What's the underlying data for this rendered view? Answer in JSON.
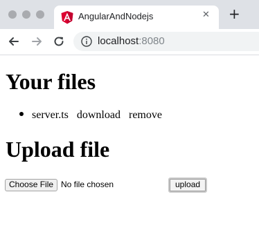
{
  "browser": {
    "tab_title": "AngularAndNodejs",
    "tab_close_glyph": "✕",
    "new_tab_glyph": "+",
    "url_host": "localhost",
    "url_port": ":8080",
    "favicon": "angular-logo",
    "colors": {
      "tabstrip": "#dee1e6",
      "favicon": "#dd0031",
      "traffic_light": "#a9abaf"
    }
  },
  "page": {
    "files_heading": "Your files",
    "files": [
      {
        "name": "server.ts",
        "download_label": "download",
        "remove_label": "remove"
      }
    ],
    "upload_heading": "Upload file",
    "choose_file_label": "Choose File",
    "no_file_text": "No file chosen",
    "upload_label": "upload"
  }
}
